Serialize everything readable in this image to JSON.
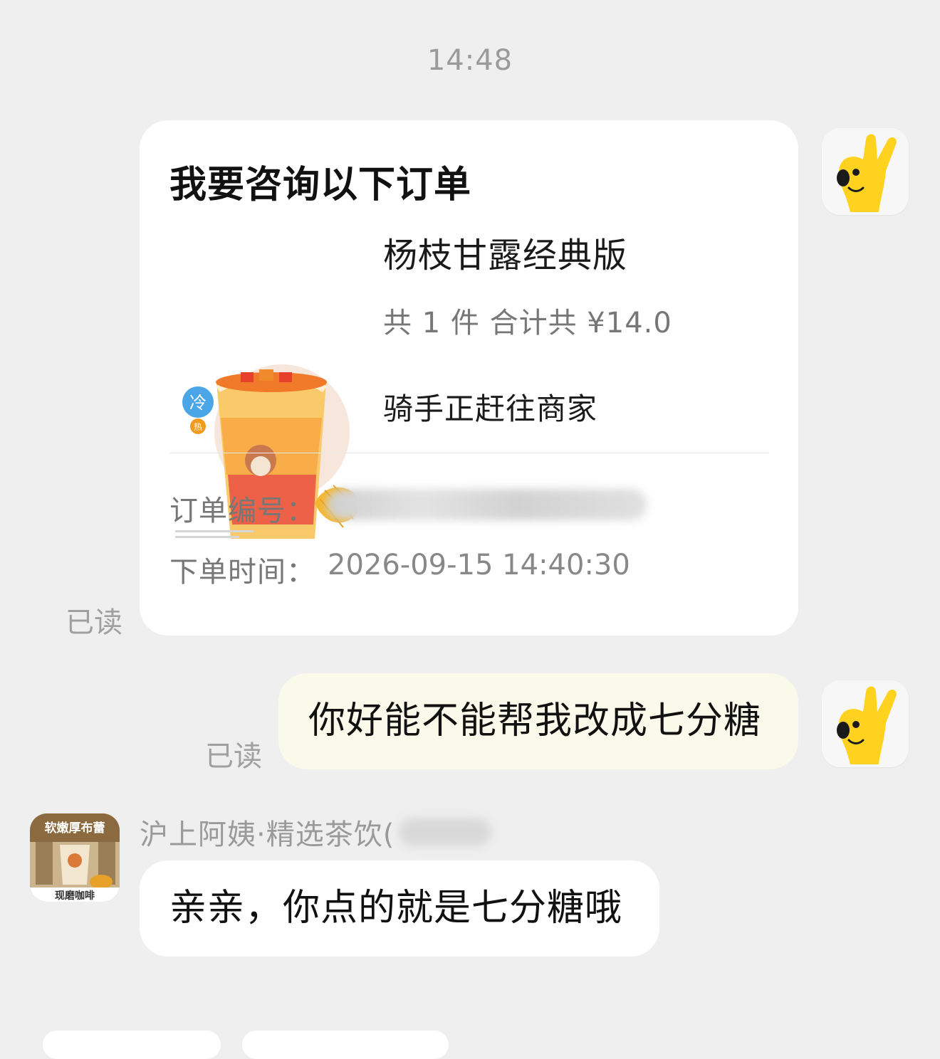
{
  "chat": {
    "timestamp": "14:48",
    "order_card": {
      "title": "我要咨询以下订单",
      "product_name": "杨枝甘露经典版",
      "summary": "共 1 件  合计共 ¥14.0",
      "status": "骑手正赶往商家",
      "order_no_label": "订单编号：",
      "order_time_label": "下单时间：",
      "order_time_value": "2026-09-15 14:40:30",
      "image_badge_cold": "冷",
      "image_badge_hot": "热",
      "read_receipt": "已读"
    },
    "user_message": {
      "text": "你好能不能帮我改成七分糖",
      "read_receipt": "已读"
    },
    "shop_message": {
      "sender_name": "沪上阿姨·精选茶饮(",
      "text": "亲亲，你点的就是七分糖哦",
      "avatar_caption_top": "软嫩厚布蕾",
      "avatar_caption_bottom": "现磨咖啡"
    }
  },
  "colors": {
    "background": "#efefef",
    "user_bubble": "#fafaea",
    "mascot_yellow": "#ffd21f"
  },
  "icons": {
    "user_avatar": "yellow-mascot-icon",
    "shop_avatar": "shop-drink-icon"
  }
}
